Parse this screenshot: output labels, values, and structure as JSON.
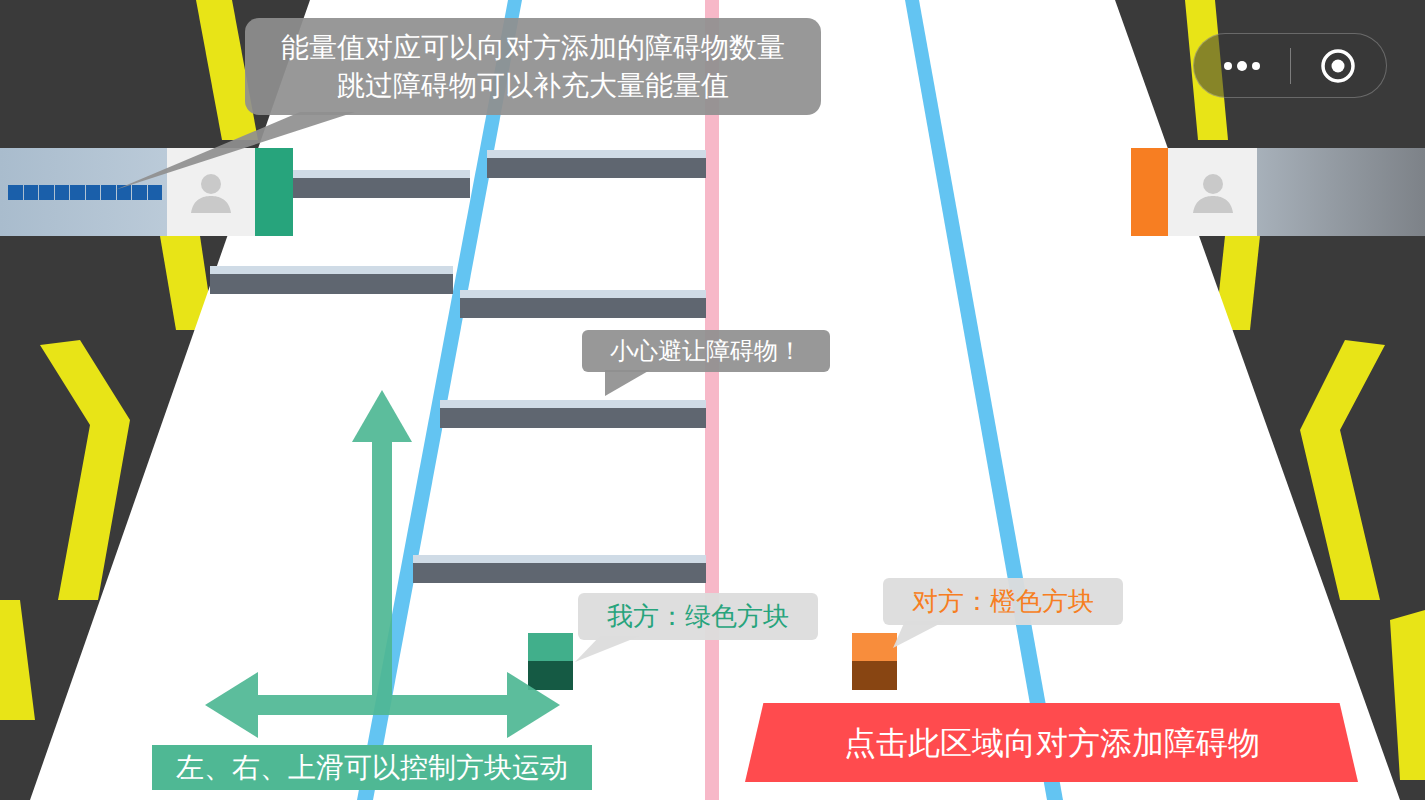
{
  "hint_energy": {
    "lines": [
      "能量值对应可以向对方添加的障碍物数量",
      "跳过障碍物可以补充大量能量值"
    ]
  },
  "hint_obstacle": {
    "text": "小心避让障碍物！"
  },
  "players": [
    {
      "side": "me",
      "label": "我方：绿色方块",
      "color": "#27a47c",
      "energy_segments": 10
    },
    {
      "side": "opponent",
      "label": "对方：橙色方块",
      "color": "#f77e22",
      "energy_segments": 0
    }
  ],
  "controls_hint": {
    "text": "左、右、上滑可以控制方块运动"
  },
  "add_obstacle_button": {
    "text": "点击此区域向对方添加障碍物"
  }
}
